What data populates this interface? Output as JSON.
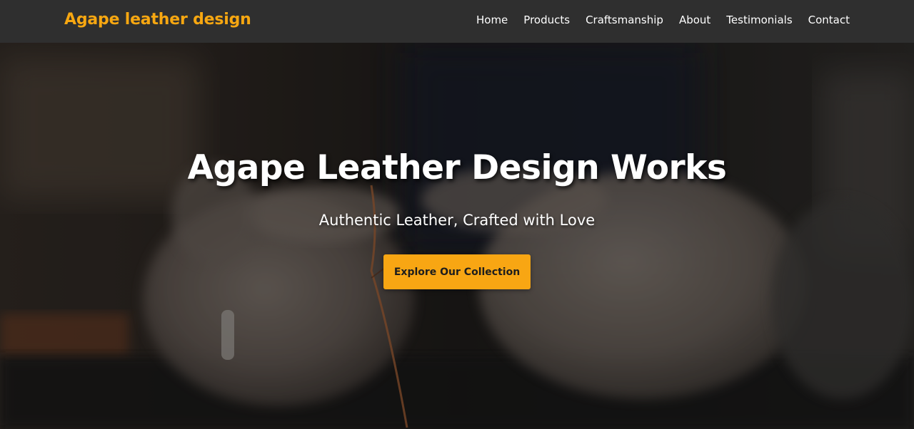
{
  "navbar": {
    "brand": "Agape leather design",
    "links": [
      {
        "label": "Home"
      },
      {
        "label": "Products"
      },
      {
        "label": "Craftsmanship"
      },
      {
        "label": "About"
      },
      {
        "label": "Testimonials"
      },
      {
        "label": "Contact"
      }
    ]
  },
  "hero": {
    "title": "Agape Leather Design Works",
    "subtitle": "Authentic Leather, Crafted with Love",
    "cta_label": "Explore Our Collection"
  },
  "colors": {
    "brand_accent": "#f7a711",
    "navbar_bg": "#2f2f2f",
    "cta_bg": "#f8a613",
    "text_light": "#ffffff"
  }
}
